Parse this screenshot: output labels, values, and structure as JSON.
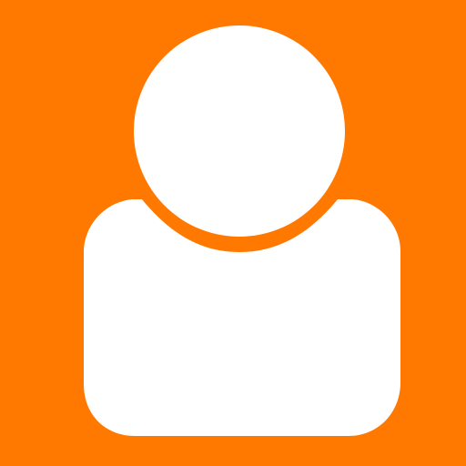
{
  "icon": {
    "name": "user-avatar-icon",
    "background_color": "#FF7800",
    "foreground_color": "#FFFFFF"
  }
}
